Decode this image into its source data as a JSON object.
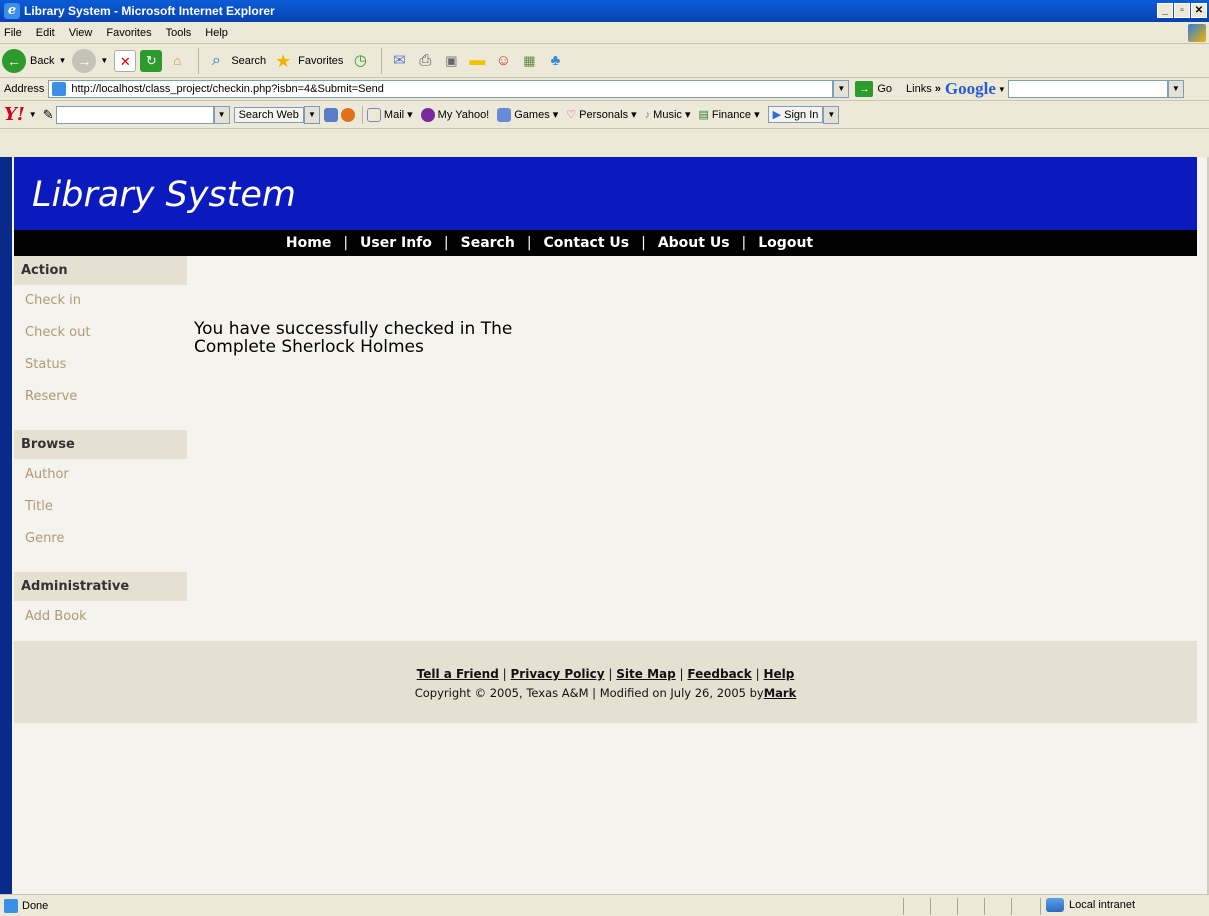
{
  "window": {
    "title": "Library System - Microsoft Internet Explorer",
    "controls": [
      "_",
      "▫",
      "✕"
    ]
  },
  "menu": [
    "File",
    "Edit",
    "View",
    "Favorites",
    "Tools",
    "Help"
  ],
  "toolbar": {
    "back": "Back",
    "search": "Search",
    "favorites": "Favorites"
  },
  "address": {
    "label": "Address",
    "url": "http://localhost/class_project/checkin.php?isbn=4&Submit=Send",
    "go": "Go",
    "links": "Links",
    "links_more": "»",
    "google": "Google"
  },
  "yahoo_toolbar": {
    "logo": "Y!",
    "search_web": "Search Web",
    "items": [
      "Mail",
      "My Yahoo!",
      "Games",
      "Personals",
      "Music",
      "Finance"
    ],
    "sign_in": "Sign In"
  },
  "site": {
    "title": "Library System",
    "nav": [
      "Home",
      "User Info",
      "Search",
      "Contact Us",
      "About Us",
      "Logout"
    ],
    "separator": "|"
  },
  "sidebar": {
    "sections": [
      {
        "heading": "Action",
        "items": [
          "Check in",
          "Check out",
          "Status",
          "Reserve"
        ]
      },
      {
        "heading": "Browse",
        "items": [
          "Author",
          "Title",
          "Genre"
        ]
      },
      {
        "heading": "Administrative",
        "items": [
          "Add Book"
        ]
      }
    ]
  },
  "main": {
    "message": "You have successfully checked in The Complete Sherlock Holmes"
  },
  "footer": {
    "links": [
      "Tell a Friend",
      "Privacy Policy",
      "Site Map",
      "Feedback",
      "Help"
    ],
    "separator": "|",
    "copyright_text": "Copyright © 2005, Texas A&M | Modified on July 26, 2005 by",
    "author": "Mark"
  },
  "status": {
    "text": "Done",
    "zone": "Local intranet"
  }
}
